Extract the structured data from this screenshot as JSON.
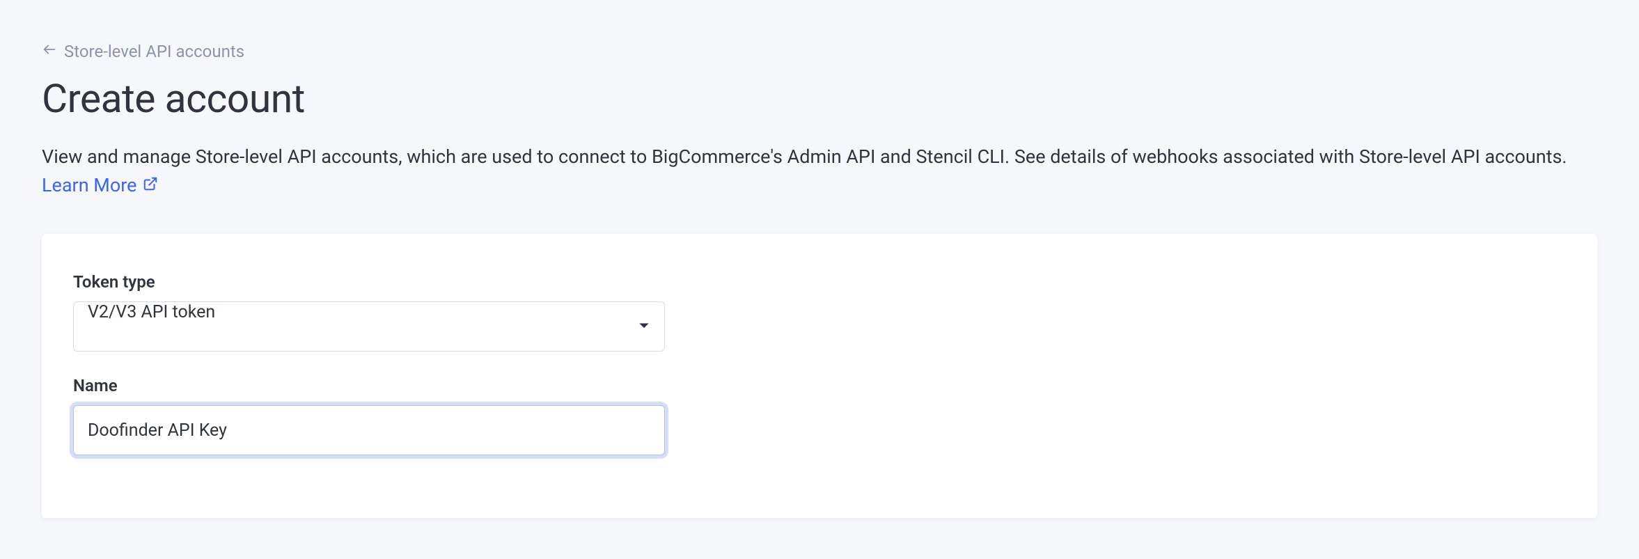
{
  "breadcrumb": {
    "label": "Store-level API accounts"
  },
  "header": {
    "title": "Create account",
    "description": "View and manage Store-level API accounts, which are used to connect to BigCommerce's Admin API and Stencil CLI. See details of webhooks associated with Store-level API accounts.",
    "learn_more_label": "Learn More"
  },
  "form": {
    "token_type": {
      "label": "Token type",
      "value": "V2/V3 API token"
    },
    "name": {
      "label": "Name",
      "value": "Doofinder API Key"
    }
  }
}
